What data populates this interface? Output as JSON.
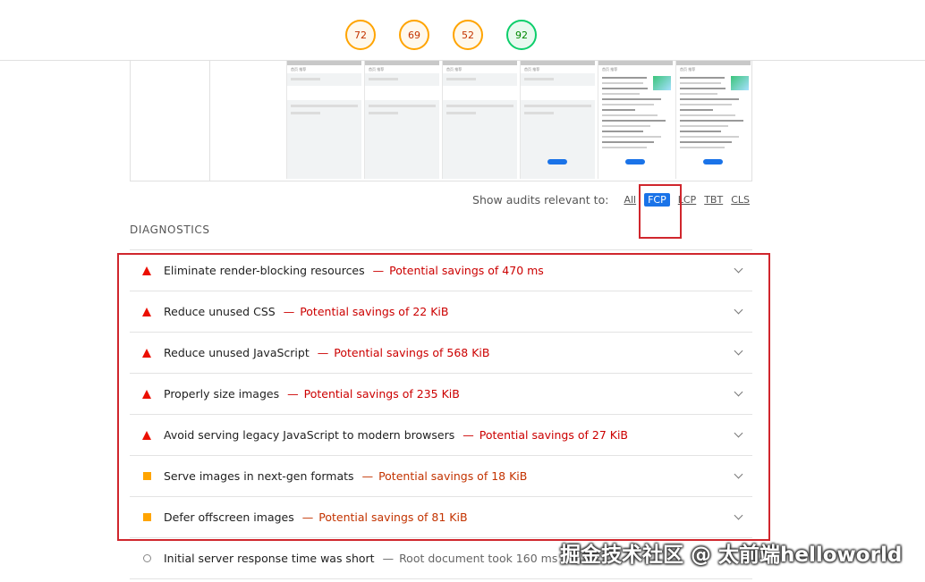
{
  "scores": [
    {
      "value": "72",
      "status": "average"
    },
    {
      "value": "69",
      "status": "average"
    },
    {
      "value": "52",
      "status": "average"
    },
    {
      "value": "92",
      "status": "pass"
    }
  ],
  "filter": {
    "label": "Show audits relevant to:",
    "options": [
      "All",
      "FCP",
      "LCP",
      "TBT",
      "CLS"
    ],
    "active": "FCP"
  },
  "filmstrip": {
    "frame_header": "首页",
    "frame_tab": "推荐"
  },
  "section_title": "DIAGNOSTICS",
  "audits": [
    {
      "title": "Eliminate render-blocking resources",
      "separator": "—",
      "display": "Potential savings of 470 ms",
      "status": "fail"
    },
    {
      "title": "Reduce unused CSS",
      "separator": "—",
      "display": "Potential savings of 22 KiB",
      "status": "fail"
    },
    {
      "title": "Reduce unused JavaScript",
      "separator": "—",
      "display": "Potential savings of 568 KiB",
      "status": "fail"
    },
    {
      "title": "Properly size images",
      "separator": "—",
      "display": "Potential savings of 235 KiB",
      "status": "fail"
    },
    {
      "title": "Avoid serving legacy JavaScript to modern browsers",
      "separator": "—",
      "display": "Potential savings of 27 KiB",
      "status": "fail"
    },
    {
      "title": "Serve images in next-gen formats",
      "separator": "—",
      "display": "Potential savings of 18 KiB",
      "status": "average"
    },
    {
      "title": "Defer offscreen images",
      "separator": "—",
      "display": "Potential savings of 81 KiB",
      "status": "average"
    },
    {
      "title": "Initial server response time was short",
      "separator": "—",
      "display": "Root document took 160 ms",
      "status": "info"
    }
  ],
  "watermark": "掘金技术社区 @ 太前端helloworld",
  "colors": {
    "fail": "#eb0f00",
    "average": "#ffa400",
    "pass": "#0cce6b",
    "active_chip": "#1a73e8",
    "annotation": "#d0262d"
  }
}
